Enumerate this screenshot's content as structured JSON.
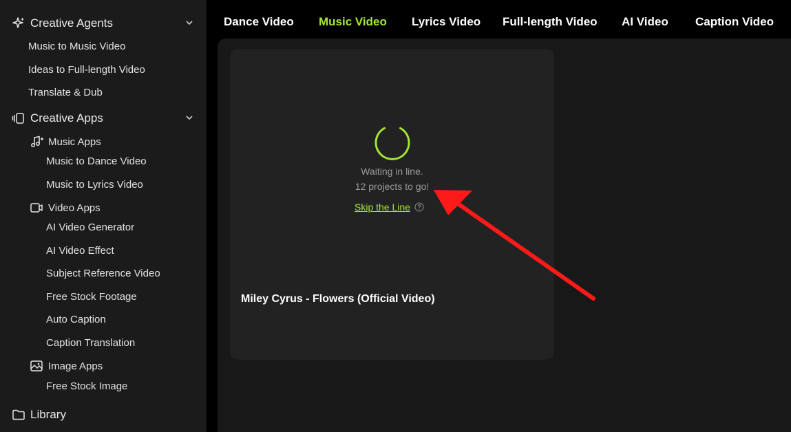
{
  "sidebar": {
    "agents": {
      "label": "Creative Agents",
      "items": [
        "Music to Music Video",
        "Ideas to Full-length Video",
        "Translate & Dub"
      ]
    },
    "apps": {
      "label": "Creative Apps",
      "music_apps": {
        "label": "Music Apps",
        "items": [
          "Music to Dance Video",
          "Music to Lyrics Video"
        ]
      },
      "video_apps": {
        "label": "Video Apps",
        "items": [
          "AI Video Generator",
          "AI Video Effect",
          "Subject Reference Video",
          "Free Stock Footage",
          "Auto Caption",
          "Caption Translation"
        ]
      },
      "image_apps": {
        "label": "Image Apps",
        "items": [
          "Free Stock Image"
        ]
      }
    },
    "library": {
      "label": "Library"
    }
  },
  "tabs": [
    {
      "label": "Dance Video",
      "active": false
    },
    {
      "label": "Music Video",
      "active": true
    },
    {
      "label": "Lyrics Video",
      "active": false
    },
    {
      "label": "Full-length Video",
      "active": false
    },
    {
      "label": "AI Video",
      "active": false
    },
    {
      "label": "Caption Video",
      "active": false
    }
  ],
  "card": {
    "status_line1": "Waiting in line.",
    "status_line2": "12 projects to go!",
    "skip_label": "Skip the Line",
    "title": "Miley Cyrus - Flowers (Official Video)"
  },
  "colors": {
    "accent": "#a3e635",
    "annotation_arrow": "#ff1a1a",
    "sidebar_bg": "#1b1b1b",
    "main_bg": "#181818",
    "card_bg": "#222222"
  },
  "icons": {
    "agents": "sparkle-icon",
    "apps": "apps-icon",
    "music_apps": "music-note-icon",
    "video_apps": "video-camera-icon",
    "image_apps": "image-icon",
    "library": "folder-icon",
    "chevron": "chevron-down-icon",
    "help": "question-circle-icon",
    "spinner": "loading-spinner-icon"
  }
}
